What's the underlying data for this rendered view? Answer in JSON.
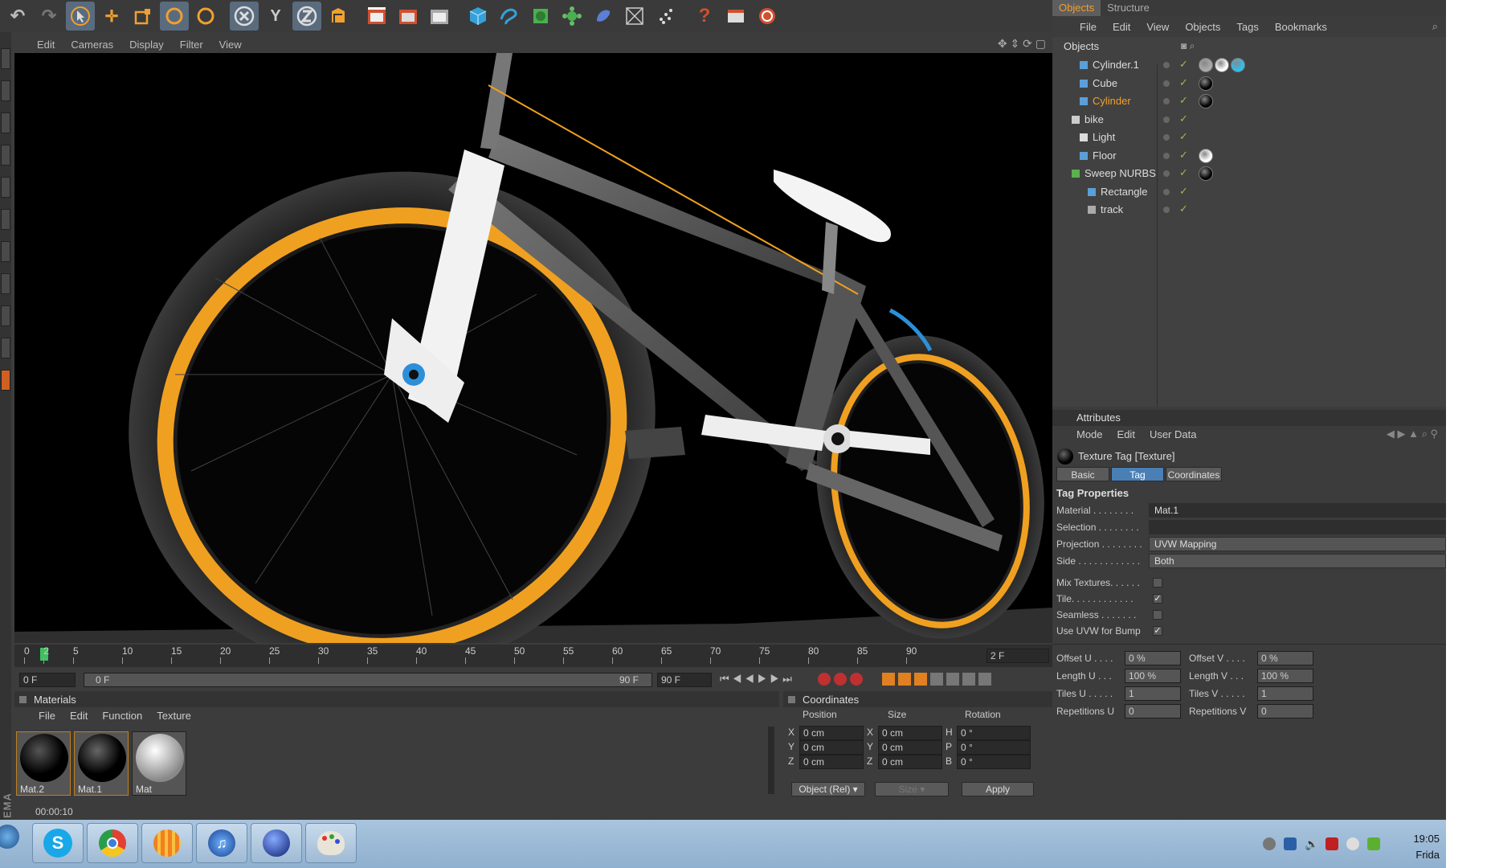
{
  "toolbar": {
    "icons": [
      "undo-icon",
      "redo-icon",
      "select-arrow-icon",
      "move-icon",
      "scale-icon",
      "rotate-icon",
      "live-select-icon",
      "x-axis-lock-icon",
      "y-axis-lock-icon",
      "z-axis-lock-icon",
      "world-coords-icon",
      "render-view-icon",
      "render-picture-viewer-icon",
      "render-settings-icon",
      "cube-primitive-icon",
      "spline-icon",
      "nurbs-icon",
      "array-icon",
      "deformer-icon",
      "scene-icon",
      "particle-icon",
      "help-icon",
      "layout-icon",
      "internet-icon"
    ],
    "y_label": "Y"
  },
  "viewport": {
    "menu": [
      "Edit",
      "Cameras",
      "Display",
      "Filter",
      "View"
    ]
  },
  "timeline": {
    "ticks": [
      "0",
      "2",
      "5",
      "10",
      "15",
      "20",
      "25",
      "30",
      "35",
      "40",
      "45",
      "50",
      "55",
      "60",
      "65",
      "70",
      "75",
      "80",
      "85",
      "90"
    ],
    "current_frame_field": "2 F",
    "start_field": "0 F",
    "range_start": "0 F",
    "range_end": "90 F",
    "end_field": "90 F"
  },
  "materials": {
    "title": "Materials",
    "menu": [
      "File",
      "Edit",
      "Function",
      "Texture"
    ],
    "items": [
      {
        "label": "Mat.2",
        "color": "#111111"
      },
      {
        "label": "Mat.1",
        "color": "#111111"
      },
      {
        "label": "Mat",
        "color": "#dddddd"
      }
    ]
  },
  "coordinates": {
    "title": "Coordinates",
    "headers": [
      "Position",
      "Size",
      "Rotation"
    ],
    "rows": [
      {
        "axis": "X",
        "pos": "0 cm",
        "size_axis": "X",
        "size": "0 cm",
        "rot_axis": "H",
        "rot": "0 °"
      },
      {
        "axis": "Y",
        "pos": "0 cm",
        "size_axis": "Y",
        "size": "0 cm",
        "rot_axis": "P",
        "rot": "0 °"
      },
      {
        "axis": "Z",
        "pos": "0 cm",
        "size_axis": "Z",
        "size": "0 cm",
        "rot_axis": "B",
        "rot": "0 °"
      }
    ],
    "mode": "Object (Rel)",
    "size_mode": "Size",
    "apply": "Apply"
  },
  "status": {
    "time": "00:00:10"
  },
  "objects_panel": {
    "tabs": [
      "Objects",
      "Structure"
    ],
    "menu": [
      "File",
      "Edit",
      "View",
      "Objects",
      "Tags",
      "Bookmarks"
    ],
    "header": "Objects",
    "items": [
      {
        "name": "Cylinder.1",
        "selected": false
      },
      {
        "name": "Cube",
        "selected": false
      },
      {
        "name": "Cylinder",
        "selected": true
      },
      {
        "name": "bike",
        "selected": false
      },
      {
        "name": "Light",
        "selected": false
      },
      {
        "name": "Floor",
        "selected": false
      },
      {
        "name": "Sweep NURBS",
        "selected": false
      },
      {
        "name": "Rectangle",
        "selected": false
      },
      {
        "name": "track",
        "selected": false
      }
    ]
  },
  "attributes": {
    "title": "Attributes",
    "menu": [
      "Mode",
      "Edit",
      "User Data"
    ],
    "tag_title": "Texture Tag [Texture]",
    "tabs": [
      "Basic",
      "Tag",
      "Coordinates"
    ],
    "section": "Tag Properties",
    "material_label": "Material . . . . . . . .",
    "material_value": "Mat.1",
    "selection_label": "Selection . . . . . . . .",
    "selection_value": "",
    "projection_label": "Projection . . . . . . . .",
    "projection_value": "UVW Mapping",
    "side_label": "Side . . . . . . . . . . . .",
    "side_value": "Both",
    "mix_label": "Mix Textures. . . . . .",
    "tile_label": "Tile. . . . . . . . . . . .",
    "seamless_label": "Seamless . . . . . . .",
    "uvwbump_label": "Use UVW for Bump",
    "offset_u_label": "Offset U . . . .",
    "offset_u": "0 %",
    "offset_v_label": "Offset V . . . .",
    "offset_v": "0 %",
    "length_u_label": "Length U . . .",
    "length_u": "100 %",
    "length_v_label": "Length V . . .",
    "length_v": "100 %",
    "tiles_u_label": "Tiles U . . . . .",
    "tiles_u": "1",
    "tiles_v_label": "Tiles V . . . . .",
    "tiles_v": "1",
    "rep_u_label": "Repetitions U",
    "rep_u": "0",
    "rep_v_label": "Repetitions V",
    "rep_v": "0"
  },
  "taskbar": {
    "apps": [
      "skype-icon",
      "chrome-icon",
      "vlc-like-icon",
      "itunes-icon",
      "cinema4d-icon",
      "paint-icon"
    ],
    "clock": "19:05",
    "day": "Frida"
  }
}
